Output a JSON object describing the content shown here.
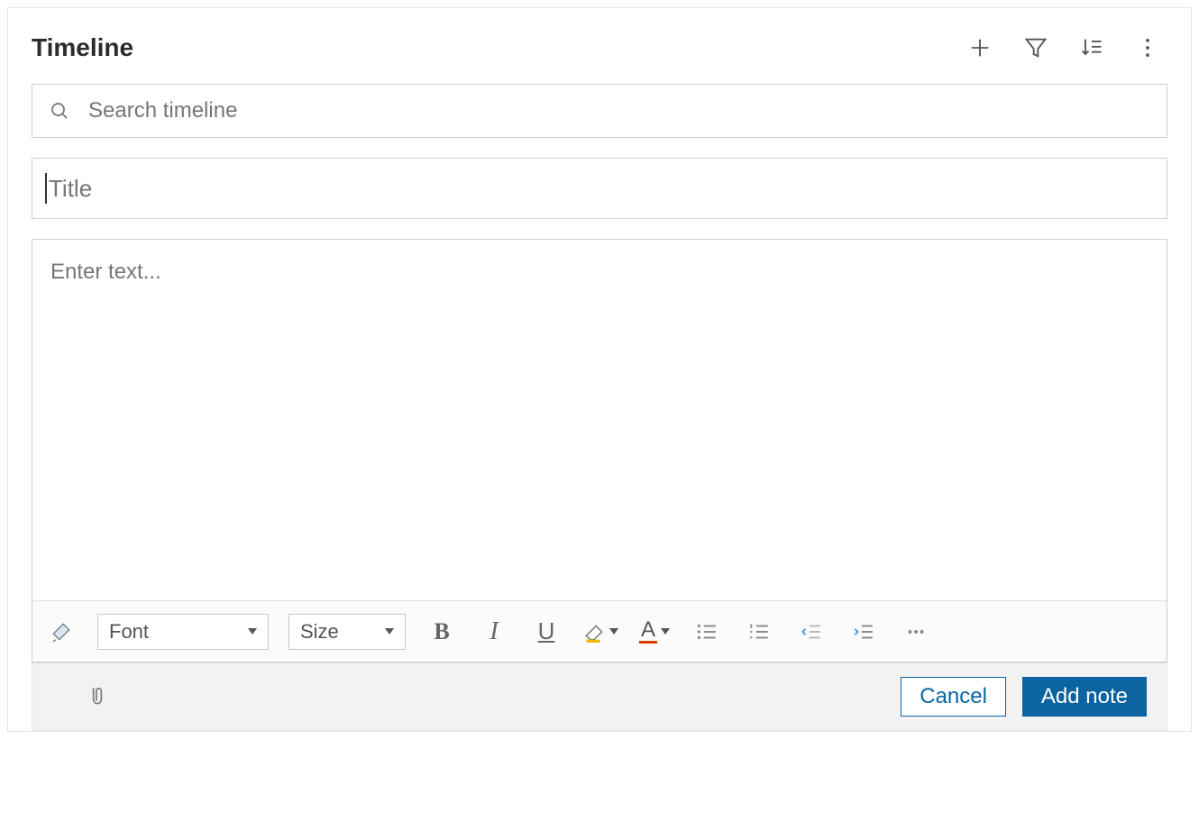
{
  "header": {
    "title": "Timeline",
    "actions": {
      "add": "plus-icon",
      "filter": "filter-icon",
      "sort": "sort-icon",
      "more": "more-vertical-icon"
    }
  },
  "search": {
    "placeholder": "Search timeline",
    "value": ""
  },
  "note": {
    "title_placeholder": "Title",
    "title_value": "",
    "body_placeholder": "Enter text...",
    "body_value": ""
  },
  "toolbar": {
    "format_painter": "format-painter-icon",
    "font_label": "Font",
    "size_label": "Size",
    "bold": "B",
    "italic": "I",
    "underline": "U",
    "highlight": "highlight-icon",
    "font_color": "A",
    "bullets": "bulleted-list-icon",
    "numbers": "numbered-list-icon",
    "outdent": "decrease-indent-icon",
    "indent": "increase-indent-icon",
    "more": "more-horizontal-icon"
  },
  "footer": {
    "attach": "paperclip-icon",
    "cancel_label": "Cancel",
    "submit_label": "Add note"
  },
  "colors": {
    "primary": "#0a64a0",
    "muted": "#767676",
    "border": "#cfcfcf",
    "highlight_accent": "#f2b800",
    "fontcolor_accent": "#d83b01"
  }
}
